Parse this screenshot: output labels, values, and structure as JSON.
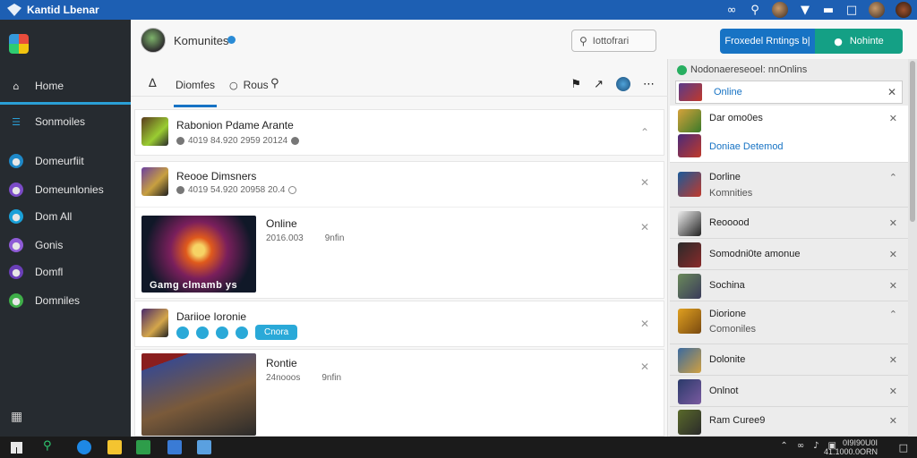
{
  "titlebar": {
    "title": "Kantid Lbenar",
    "icons": [
      "bell-icon",
      "avatar",
      "chevron-down-icon",
      "minimize-icon",
      "maximize-icon",
      "avatar",
      "avatar"
    ]
  },
  "sidebar": {
    "items": [
      {
        "label": "Home",
        "icon": "home-icon"
      },
      {
        "label": "Sonmoiles",
        "icon": "list-icon"
      },
      {
        "label": "Domeurfiit",
        "icon": "discord-icon"
      },
      {
        "label": "Domeunlonies",
        "icon": "community-icon"
      },
      {
        "label": "Dom All",
        "icon": "globe-icon"
      },
      {
        "label": "Gonis",
        "icon": "game-icon"
      },
      {
        "label": "Domfl",
        "icon": "spark-icon"
      },
      {
        "label": "Domniles",
        "icon": "leaf-icon"
      }
    ]
  },
  "header": {
    "community_name": "Komunites",
    "search_placeholder": "Iottofrari",
    "primary_button": "Froxedel Rntings b|",
    "secondary_button": "Nohinte"
  },
  "tabs": {
    "main": "Diomfes",
    "second": "Rous"
  },
  "feed": [
    {
      "title": "Rabonion Pdame Arante",
      "meta": "4019 84.920 2959 20124"
    },
    {
      "title": "Reooe Dimsners",
      "meta": "4019 54.920 20958 20.4"
    },
    {
      "title": "Online",
      "meta1": "2016.003",
      "meta2": "9nfin",
      "caption": "Gamg clmamb ys"
    },
    {
      "title": "Dariioe Ioronie",
      "pill": "Cnora"
    },
    {
      "title": "Rontie",
      "meta1": "24nooos",
      "meta2": "9nfin"
    }
  ],
  "right_panel": {
    "status": "Nodonaereseoel: nnOnlins",
    "search_label": "Online",
    "card": {
      "name1": "Dar omo0es",
      "name2": "Doniae Detemod"
    },
    "rows": [
      {
        "name1": "Dorline",
        "name2": "Komnities"
      },
      {
        "name1": "Reooood",
        "name2": ""
      },
      {
        "name1": "Somodni0te amonue",
        "name2": ""
      },
      {
        "name1": "Sochina",
        "name2": ""
      },
      {
        "name1": "Diorione",
        "name2": "Comoniles"
      },
      {
        "name1": "Dolonite",
        "name2": ""
      },
      {
        "name1": "Onlnot",
        "name2": ""
      },
      {
        "name1": "Ram Curee9",
        "name2": ""
      }
    ]
  },
  "taskbar": {
    "clock_line1": "0I9I90U0I",
    "clock_line2": "41.1000.0ORN"
  },
  "colors": {
    "titlebar": "#1d5fb3",
    "sidebar": "#262b30",
    "accent": "#1773c4",
    "green": "#14a085"
  }
}
